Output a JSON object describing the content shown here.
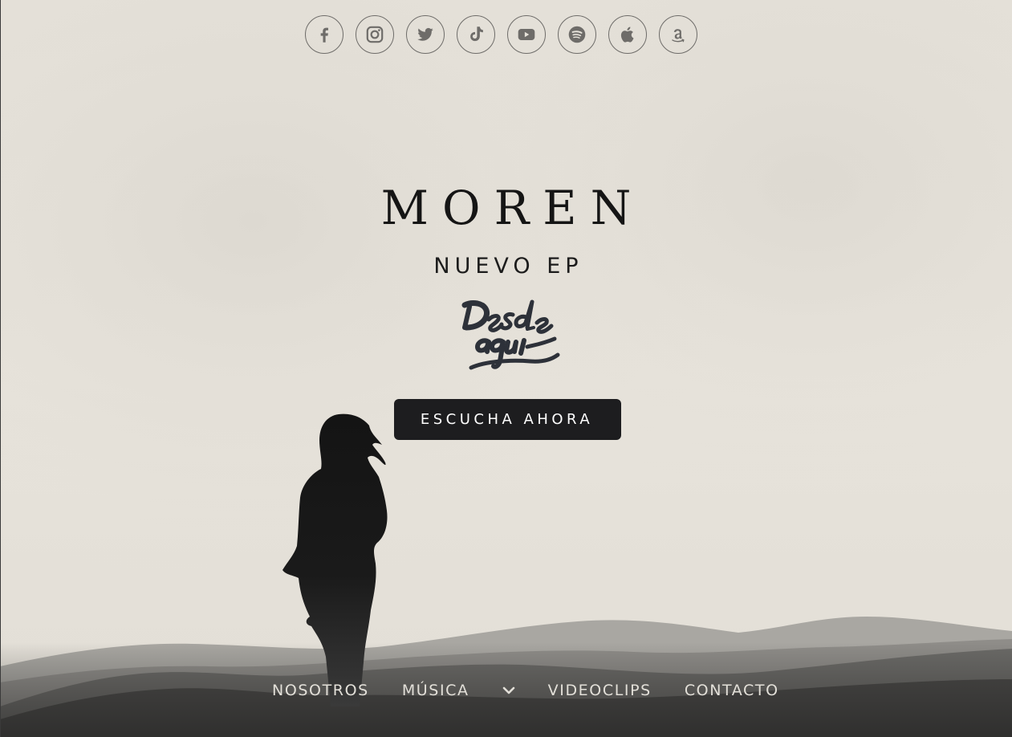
{
  "social": {
    "items": [
      {
        "name": "facebook-icon",
        "label": "Facebook"
      },
      {
        "name": "instagram-icon",
        "label": "Instagram"
      },
      {
        "name": "twitter-icon",
        "label": "Twitter"
      },
      {
        "name": "tiktok-icon",
        "label": "TikTok"
      },
      {
        "name": "youtube-icon",
        "label": "YouTube"
      },
      {
        "name": "spotify-icon",
        "label": "Spotify"
      },
      {
        "name": "apple-icon",
        "label": "Apple Music"
      },
      {
        "name": "amazon-icon",
        "label": "Amazon Music"
      }
    ],
    "icon_color": "#6e6c69"
  },
  "hero": {
    "band_name": "MOREN",
    "subtitle": "NUEVO EP",
    "ep_logo_text": "Desde aquí",
    "cta_label": "ESCUCHA AHORA"
  },
  "nav": {
    "items": [
      "NOSOTROS",
      "MÚSICA",
      "VIDEOCLIPS",
      "CONTACTO"
    ],
    "dropdown_icon": "chevron-down-icon"
  },
  "colors": {
    "background": "#e6e2da",
    "text_dark": "#151515",
    "button_bg": "#1d1d1f",
    "nav_text": "#e2dfd8"
  }
}
